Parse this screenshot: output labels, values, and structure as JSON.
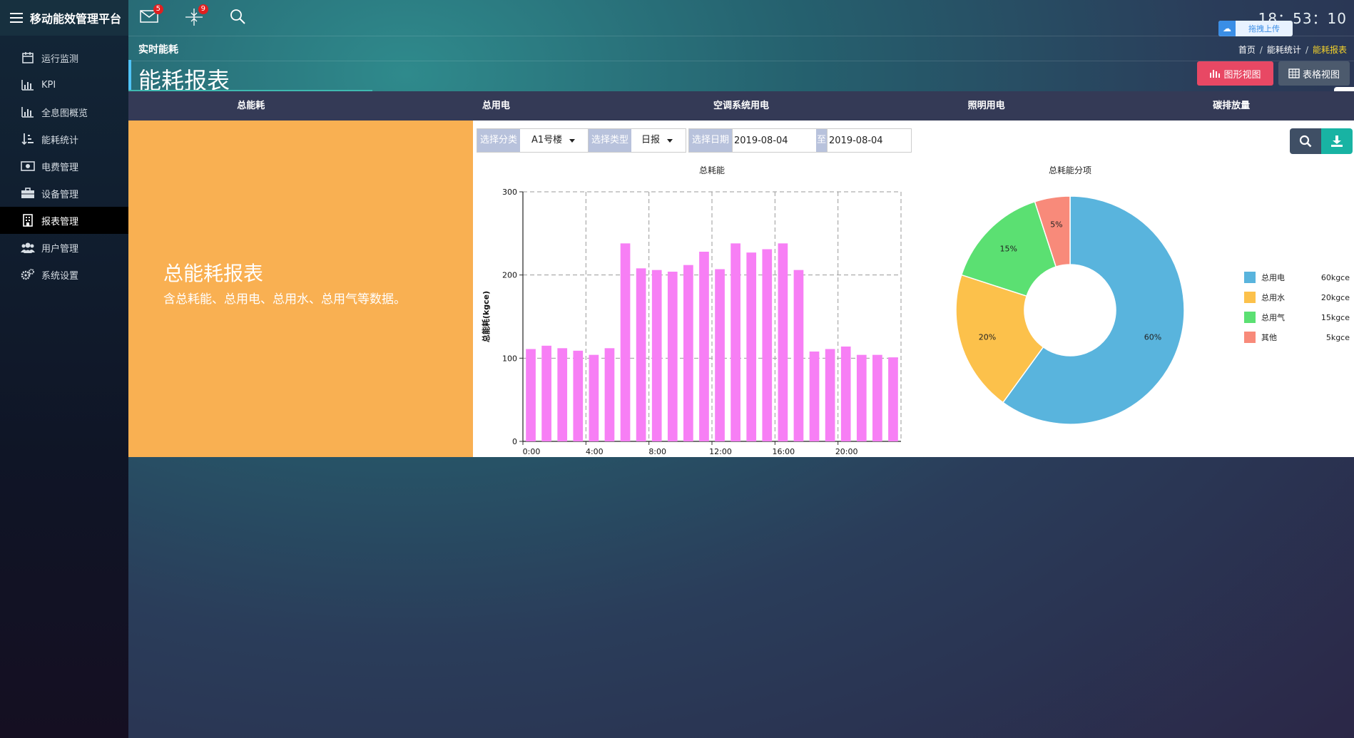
{
  "app": {
    "title": "移动能效管理平台"
  },
  "topbar": {
    "mail_badge": "5",
    "alerts_badge": "9",
    "clock": "18：53：10",
    "upload_label": "拖拽上传"
  },
  "sidebar": {
    "items": [
      {
        "label": "运行监测",
        "icon": "calendar-icon"
      },
      {
        "label": "KPI",
        "icon": "bar-chart-icon"
      },
      {
        "label": "全息图概览",
        "icon": "bar-chart-icon"
      },
      {
        "label": "能耗统计",
        "icon": "sort-icon"
      },
      {
        "label": "电费管理",
        "icon": "money-icon"
      },
      {
        "label": "设备管理",
        "icon": "briefcase-icon"
      },
      {
        "label": "报表管理",
        "icon": "building-icon"
      },
      {
        "label": "用户管理",
        "icon": "users-icon"
      },
      {
        "label": "系统设置",
        "icon": "gears-icon"
      }
    ],
    "active_index": 6
  },
  "header": {
    "subtitle": "实时能耗",
    "breadcrumb": [
      "首页",
      "能耗统计",
      "能耗报表"
    ],
    "page_title": "能耗报表",
    "graph_view_label": "图形视图",
    "table_view_label": "表格视图"
  },
  "tabs": [
    "总能耗",
    "总用电",
    "空调系统用电",
    "照明用电",
    "碳排放量"
  ],
  "intro": {
    "title": "总能耗报表",
    "description": "含总耗能、总用电、总用水、总用气等数据。"
  },
  "filters": {
    "category_label": "选择分类",
    "category_value": "A1号楼",
    "type_label": "选择类型",
    "type_value": "日报",
    "date_label": "选择日期",
    "date_from": "2019-08-04",
    "to_label": "至",
    "date_to": "2019-08-04"
  },
  "colors": {
    "bar": "#f77ff5",
    "accent_red": "#e84864",
    "accent_teal": "#18b3a3",
    "sidebar_active": "#000000"
  },
  "chart_data": [
    {
      "type": "bar",
      "title": "总耗能",
      "ylabel": "总能耗(kgce)",
      "xlabel": "",
      "ylim": [
        0,
        300
      ],
      "yticks": [
        "0",
        "100",
        "200",
        "300"
      ],
      "xticks": [
        "0:00",
        "4:00",
        "8:00",
        "12:00",
        "16:00",
        "20:00"
      ],
      "categories": [
        "0:00",
        "1:00",
        "2:00",
        "3:00",
        "4:00",
        "5:00",
        "6:00",
        "7:00",
        "8:00",
        "9:00",
        "10:00",
        "11:00",
        "12:00",
        "13:00",
        "14:00",
        "15:00",
        "16:00",
        "17:00",
        "18:00",
        "19:00",
        "20:00",
        "21:00",
        "22:00",
        "23:00"
      ],
      "values": [
        111,
        115,
        112,
        109,
        104,
        112,
        238,
        208,
        206,
        204,
        212,
        228,
        207,
        238,
        227,
        231,
        238,
        206,
        108,
        111,
        114,
        104,
        104,
        101
      ],
      "grid": true
    },
    {
      "type": "pie",
      "title": "总耗能分项",
      "donut": true,
      "labels": [
        "总用电",
        "总用水",
        "总用气",
        "其他"
      ],
      "values": [
        60,
        20,
        15,
        5
      ],
      "value_labels": [
        "60kgce",
        "20kgce",
        "15kgce",
        "5kgce"
      ],
      "percent_labels": [
        "60%",
        "20%",
        "15%",
        "5%"
      ],
      "colors": [
        "#59b4dd",
        "#fcc14b",
        "#5be072",
        "#f88a7a"
      ],
      "legend": "right"
    }
  ]
}
